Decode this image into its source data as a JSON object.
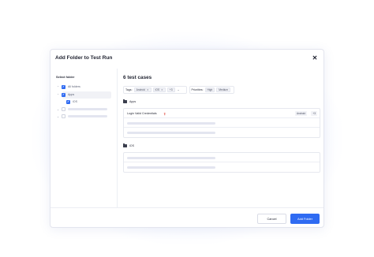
{
  "modal": {
    "title": "Add Folder to Test Run",
    "close_glyph": "✕"
  },
  "sidebar": {
    "heading": "Select folder",
    "items": [
      {
        "label": "All folders",
        "checked": true,
        "chevron": "⌃"
      },
      {
        "label": "Apps",
        "checked": true,
        "chevron": "⌃"
      },
      {
        "label": "iOS",
        "checked": true
      },
      {
        "label": "",
        "checked": false,
        "chevron": "⌄"
      },
      {
        "label": "",
        "checked": false,
        "chevron": "⌄"
      }
    ]
  },
  "content": {
    "title": "6 test cases",
    "filters": {
      "tags_label": "Tags:",
      "tags": [
        "Android",
        "iOS"
      ],
      "tags_more": "+3",
      "priorities_label": "Priorities:",
      "priorities": [
        "High",
        "Medium"
      ],
      "remove_glyph": "✕",
      "dropdown_glyph": "⌄"
    },
    "sections": [
      {
        "name": "Apps",
        "cases": [
          {
            "name": "Login Valid Credentials",
            "priority_glyph": "⇧",
            "tag": "Android",
            "more": "+3"
          }
        ]
      },
      {
        "name": "iOS"
      }
    ]
  },
  "footer": {
    "cancel_label": "Cancel",
    "add_label": "Add Folder"
  },
  "colors": {
    "accent": "#2f6bf2",
    "priority_high": "#e0453a"
  }
}
